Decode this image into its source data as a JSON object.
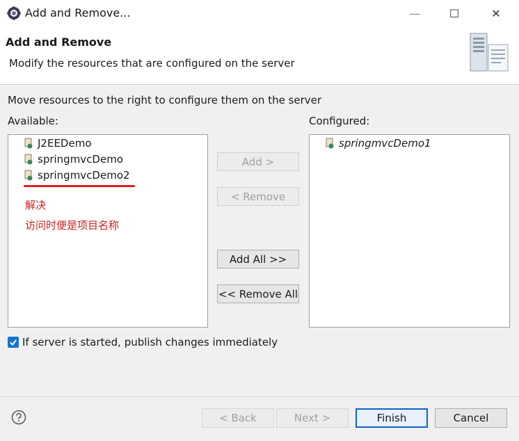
{
  "window": {
    "title": "Add and Remove...",
    "minimize": "—",
    "maximize": "☐",
    "close": "✕"
  },
  "header": {
    "title": "Add and Remove",
    "description": "Modify the resources that are configured on the server"
  },
  "main": {
    "instruction": "Move resources to the right to configure them on the server",
    "available_label": "Available:",
    "configured_label": "Configured:",
    "available_items": [
      "J2EEDemo",
      "springmvcDemo",
      "springmvcDemo2"
    ],
    "configured_items": [
      "springmvcDemo1"
    ],
    "annotation": {
      "line1": "解决",
      "line2": "访问时便是项目名称",
      "color": "#e02020"
    }
  },
  "buttons": {
    "add": "Add >",
    "remove": "< Remove",
    "add_all": "Add All >>",
    "remove_all": "<< Remove All"
  },
  "publish_checkbox": {
    "label": "If server is started, publish changes immediately",
    "checked": true
  },
  "footer": {
    "back": "< Back",
    "next": "Next >",
    "finish": "Finish",
    "cancel": "Cancel"
  },
  "colors": {
    "accent": "#1976d2",
    "finish_border": "#0a64c8"
  }
}
